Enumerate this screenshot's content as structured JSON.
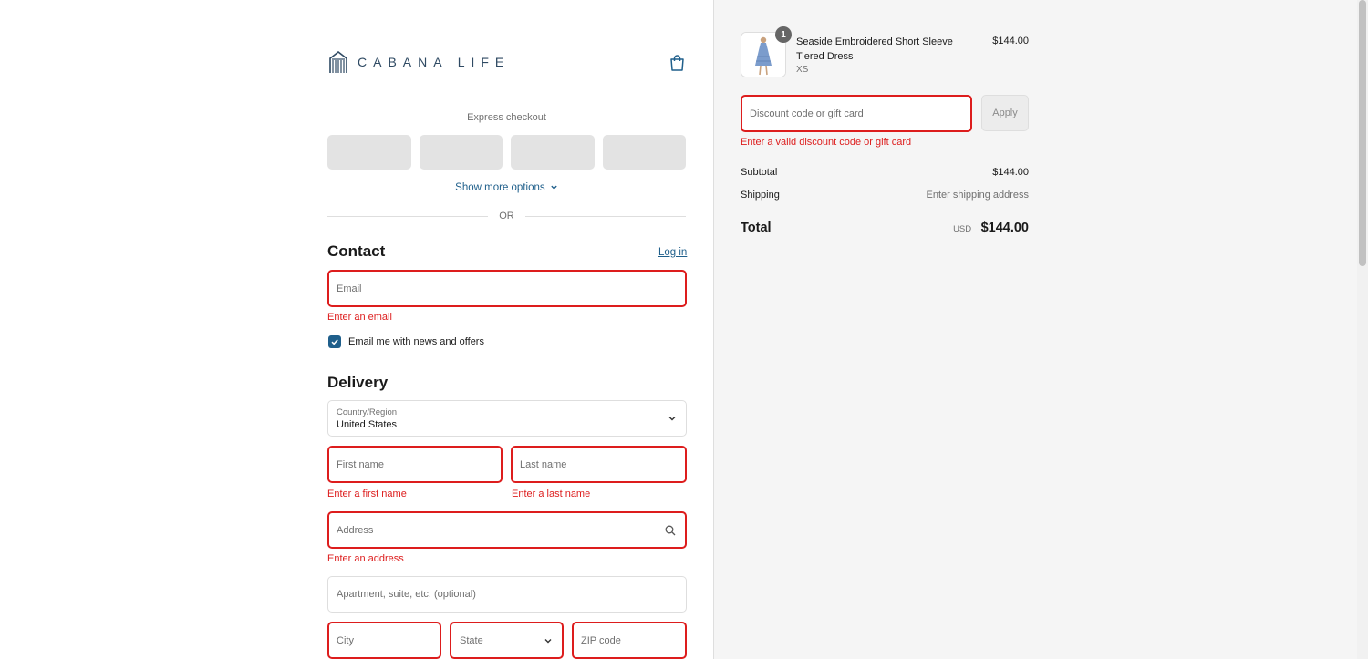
{
  "brand": {
    "name": "CABANA LIFE"
  },
  "express": {
    "label": "Express checkout",
    "show_more": "Show more options",
    "or": "OR"
  },
  "contact": {
    "heading": "Contact",
    "login": "Log in",
    "email_placeholder": "Email",
    "email_error": "Enter an email",
    "newsletter_label": "Email me with news and offers",
    "newsletter_checked": true
  },
  "delivery": {
    "heading": "Delivery",
    "country_label": "Country/Region",
    "country_value": "United States",
    "first_name_placeholder": "First name",
    "first_name_error": "Enter a first name",
    "last_name_placeholder": "Last name",
    "last_name_error": "Enter a last name",
    "address_placeholder": "Address",
    "address_error": "Enter an address",
    "apartment_placeholder": "Apartment, suite, etc. (optional)",
    "city_placeholder": "City",
    "state_placeholder": "State",
    "zip_placeholder": "ZIP code"
  },
  "cart": {
    "item": {
      "quantity": "1",
      "name": "Seaside Embroidered Short Sleeve Tiered Dress",
      "variant": "XS",
      "price": "$144.00"
    },
    "discount_placeholder": "Discount code or gift card",
    "apply_label": "Apply",
    "discount_error": "Enter a valid discount code or gift card",
    "subtotal_label": "Subtotal",
    "subtotal_value": "$144.00",
    "shipping_label": "Shipping",
    "shipping_value": "Enter shipping address",
    "total_label": "Total",
    "total_currency": "USD",
    "total_value": "$144.00"
  },
  "colors": {
    "accent": "#1f5f8b",
    "error": "#dd1d1d",
    "brand": "#2f4a63"
  }
}
